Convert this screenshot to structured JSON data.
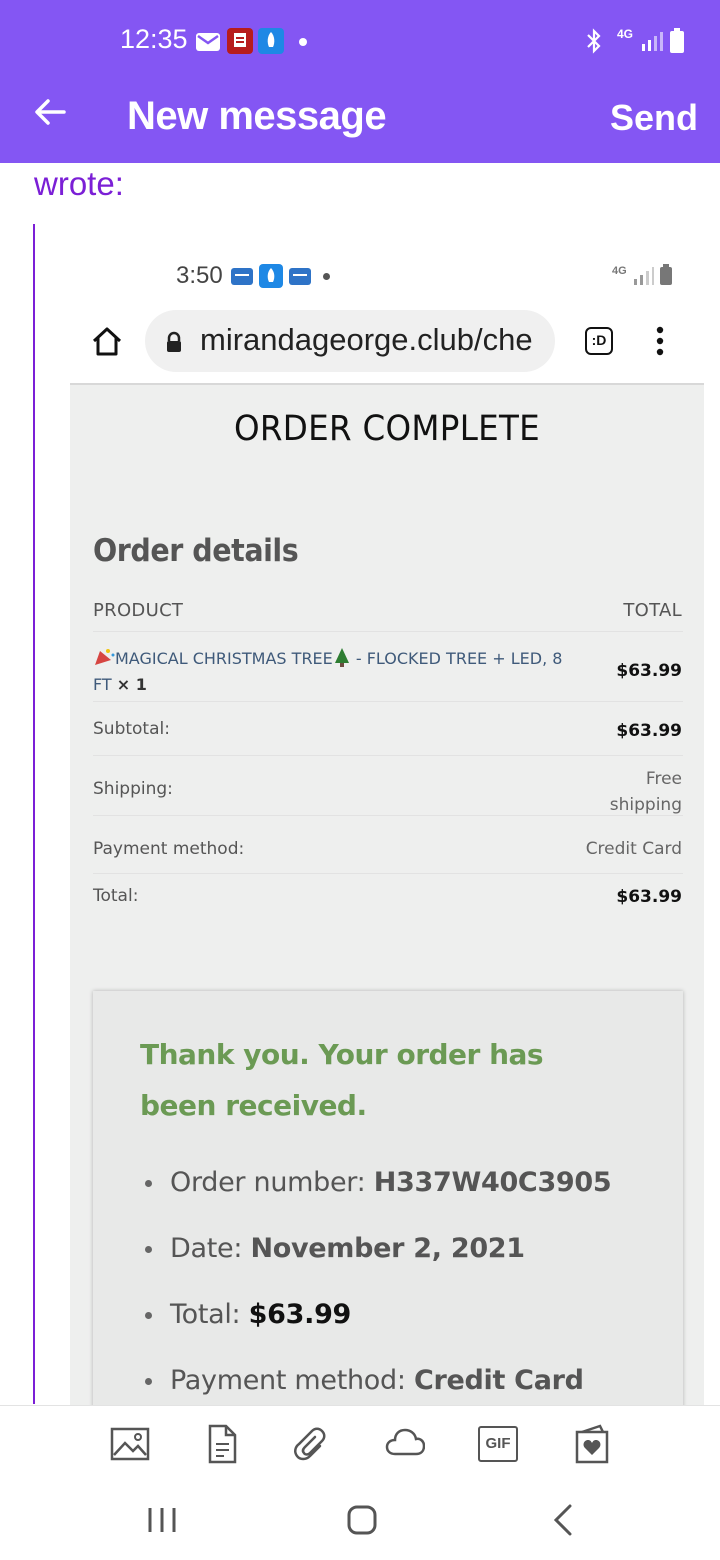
{
  "status_bar": {
    "time": "12:35",
    "network": "4G"
  },
  "header": {
    "title": "New message",
    "send_label": "Send"
  },
  "email": {
    "wrote_label": "wrote:"
  },
  "embedded": {
    "status_time": "3:50",
    "network": "4G",
    "url": "mirandageorge.club/che",
    "tab_label": ":D",
    "page": {
      "heading": "ORDER COMPLETE",
      "details_title": "Order details",
      "col_product": "PRODUCT",
      "col_total": "TOTAL",
      "product_line1": "MAGICAL CHRISTMAS TREE",
      "product_line1b": " - FLOCKED TREE + LED, 8",
      "product_line2": "FT",
      "product_qty": "× 1",
      "product_total": "$63.99",
      "rows": [
        {
          "label": "Subtotal:",
          "value": "$63.99"
        },
        {
          "label": "Shipping:",
          "value": "Free shipping"
        },
        {
          "label": "Payment method:",
          "value": "Credit Card"
        },
        {
          "label": "Total:",
          "value": "$63.99"
        }
      ],
      "thanks": "Thank you. Your order has been received.",
      "order_number_label": "Order number:",
      "order_number": "H337W40C3905",
      "date_label": "Date:",
      "date": "November 2, 2021",
      "total_label": "Total:",
      "total": "$63.99",
      "payment_label": "Payment method:",
      "payment": "Credit Card"
    }
  },
  "toolbar": {
    "gif_label": "GIF"
  },
  "colors": {
    "appbar": "#8456f3",
    "quote": "#7b1fd6",
    "thanks_green": "#6b9a54"
  }
}
